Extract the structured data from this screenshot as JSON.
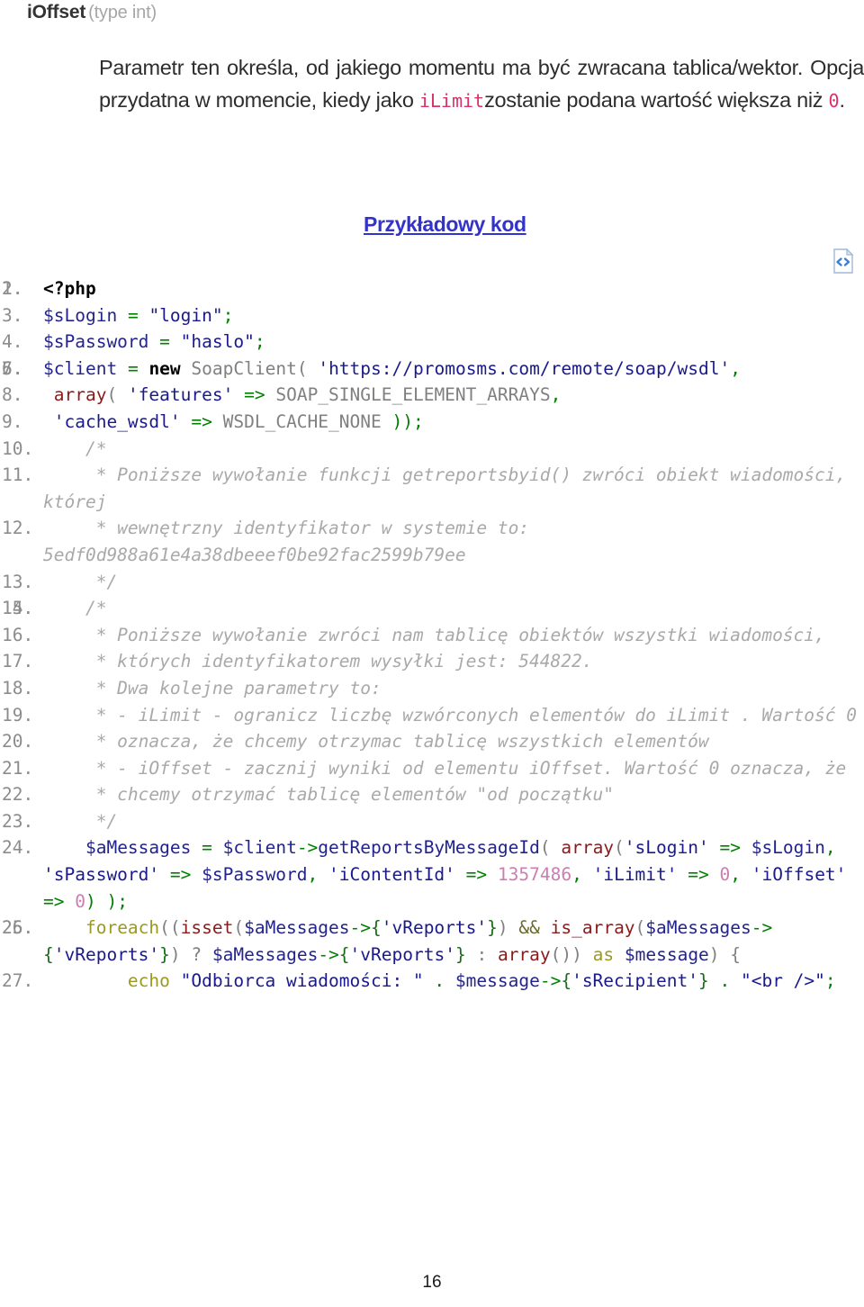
{
  "page": {
    "number": "16"
  },
  "param": {
    "name": "iOffset",
    "type_label": "(type int)"
  },
  "description": {
    "part1": "Parametr ten określa, od jakiego momentu ma być zwracana tablica/wektor. Opcja przydatna w momencie, kiedy jako ",
    "code1": "iLimit",
    "part2": "zostanie podana wartość większa niż ",
    "code2": "0",
    "part3": "."
  },
  "section": {
    "heading": "Przykładowy kod",
    "icon": "code-file-icon"
  },
  "code": {
    "language": "php",
    "lines": [
      {
        "n": "1.",
        "tokens": []
      },
      {
        "n": "2.",
        "tokens": [
          {
            "t": "kw",
            "s": "<?php"
          }
        ]
      },
      {
        "n": "3.",
        "tokens": [
          {
            "t": "var",
            "s": "$sLogin"
          },
          {
            "t": "plain",
            "s": " "
          },
          {
            "t": "op",
            "s": "="
          },
          {
            "t": "plain",
            "s": " "
          },
          {
            "t": "str",
            "s": "\"login\""
          },
          {
            "t": "op",
            "s": ";"
          }
        ]
      },
      {
        "n": "4.",
        "tokens": [
          {
            "t": "var",
            "s": "$sPassword"
          },
          {
            "t": "plain",
            "s": " "
          },
          {
            "t": "op",
            "s": "="
          },
          {
            "t": "plain",
            "s": " "
          },
          {
            "t": "str",
            "s": "\"haslo\""
          },
          {
            "t": "op",
            "s": ";"
          }
        ]
      },
      {
        "n": "5.",
        "tokens": []
      },
      {
        "n": "6.",
        "tokens": []
      },
      {
        "n": "7.",
        "tokens": [
          {
            "t": "var",
            "s": "$client"
          },
          {
            "t": "plain",
            "s": " "
          },
          {
            "t": "op",
            "s": "="
          },
          {
            "t": "plain",
            "s": " "
          },
          {
            "t": "kw",
            "s": "new"
          },
          {
            "t": "plain",
            "s": " "
          },
          {
            "t": "const",
            "s": "SoapClient"
          },
          {
            "t": "punc",
            "s": "("
          },
          {
            "t": "plain",
            "s": " "
          },
          {
            "t": "str",
            "s": "'https://promosms.com/remote/soap/wsdl'"
          },
          {
            "t": "op",
            "s": ","
          }
        ]
      },
      {
        "n": "8.",
        "tokens": [
          {
            "t": "plain",
            "s": " "
          },
          {
            "t": "fn",
            "s": "array"
          },
          {
            "t": "punc",
            "s": "("
          },
          {
            "t": "plain",
            "s": " "
          },
          {
            "t": "str",
            "s": "'features'"
          },
          {
            "t": "plain",
            "s": " "
          },
          {
            "t": "op",
            "s": "=>"
          },
          {
            "t": "plain",
            "s": " "
          },
          {
            "t": "const",
            "s": "SOAP_SINGLE_ELEMENT_ARRAYS"
          },
          {
            "t": "op",
            "s": ","
          }
        ]
      },
      {
        "n": "9.",
        "tokens": [
          {
            "t": "plain",
            "s": " "
          },
          {
            "t": "str",
            "s": "'cache_wsdl'"
          },
          {
            "t": "plain",
            "s": " "
          },
          {
            "t": "op",
            "s": "=>"
          },
          {
            "t": "plain",
            "s": " "
          },
          {
            "t": "const",
            "s": "WSDL_CACHE_NONE"
          },
          {
            "t": "plain",
            "s": " "
          },
          {
            "t": "op",
            "s": "));"
          }
        ]
      },
      {
        "n": "10.",
        "tokens": [
          {
            "t": "comment",
            "s": "    /*"
          }
        ]
      },
      {
        "n": "11.",
        "tokens": [
          {
            "t": "comment",
            "s": "     * Poniższe wywołanie funkcji getreportsbyid() zwróci obiekt wiadomości, której"
          }
        ]
      },
      {
        "n": "12.",
        "tokens": [
          {
            "t": "comment",
            "s": "     * wewnętrzny identyfikator w systemie to: 5edf0d988a61e4a38dbeeef0be92fac2599b79ee"
          }
        ]
      },
      {
        "n": "13.",
        "tokens": [
          {
            "t": "comment",
            "s": "     */"
          }
        ]
      },
      {
        "n": "14.",
        "tokens": []
      },
      {
        "n": "15.",
        "tokens": [
          {
            "t": "comment",
            "s": "    /*"
          }
        ]
      },
      {
        "n": "16.",
        "tokens": [
          {
            "t": "comment",
            "s": "     * Poniższe wywołanie zwróci nam tablicę obiektów wszystki wiadomości,"
          }
        ]
      },
      {
        "n": "17.",
        "tokens": [
          {
            "t": "comment",
            "s": "     * których identyfikatorem wysyłki jest: 544822."
          }
        ]
      },
      {
        "n": "18.",
        "tokens": [
          {
            "t": "comment",
            "s": "     * Dwa kolejne parametry to:"
          }
        ]
      },
      {
        "n": "19.",
        "tokens": [
          {
            "t": "comment",
            "s": "     * - iLimit - ogranicz liczbę wzwórconych elementów do iLimit . Wartość 0"
          }
        ]
      },
      {
        "n": "20.",
        "tokens": [
          {
            "t": "comment",
            "s": "     * oznacza, że chcemy otrzymac tablicę wszystkich elementów"
          }
        ]
      },
      {
        "n": "21.",
        "tokens": [
          {
            "t": "comment",
            "s": "     * - iOffset - zacznij wyniki od elementu iOffset. Wartość 0 oznacza, że"
          }
        ]
      },
      {
        "n": "22.",
        "tokens": [
          {
            "t": "comment",
            "s": "     * chcemy otrzymać tablicę elementów \"od początku\""
          }
        ]
      },
      {
        "n": "23.",
        "tokens": [
          {
            "t": "comment",
            "s": "     */"
          }
        ]
      },
      {
        "n": "24.",
        "tokens": [
          {
            "t": "plain",
            "s": "    "
          },
          {
            "t": "var",
            "s": "$aMessages"
          },
          {
            "t": "plain",
            "s": " "
          },
          {
            "t": "op",
            "s": "="
          },
          {
            "t": "plain",
            "s": " "
          },
          {
            "t": "var",
            "s": "$client"
          },
          {
            "t": "op",
            "s": "->"
          },
          {
            "t": "var",
            "s": "getReportsByMessageId"
          },
          {
            "t": "punc",
            "s": "("
          },
          {
            "t": "plain",
            "s": " "
          },
          {
            "t": "fn",
            "s": "array"
          },
          {
            "t": "punc",
            "s": "("
          },
          {
            "t": "str",
            "s": "'sLogin'"
          },
          {
            "t": "plain",
            "s": " "
          },
          {
            "t": "op",
            "s": "=>"
          },
          {
            "t": "plain",
            "s": " "
          },
          {
            "t": "var",
            "s": "$sLogin"
          },
          {
            "t": "op",
            "s": ","
          },
          {
            "t": "plain",
            "s": " "
          },
          {
            "t": "str",
            "s": "'sPassword'"
          },
          {
            "t": "plain",
            "s": " "
          },
          {
            "t": "op",
            "s": "=>"
          },
          {
            "t": "plain",
            "s": " "
          },
          {
            "t": "var",
            "s": "$sPassword"
          },
          {
            "t": "op",
            "s": ","
          },
          {
            "t": "plain",
            "s": " "
          },
          {
            "t": "str",
            "s": "'iContentId'"
          },
          {
            "t": "plain",
            "s": " "
          },
          {
            "t": "op",
            "s": "=>"
          },
          {
            "t": "plain",
            "s": " "
          },
          {
            "t": "num",
            "s": "1357486"
          },
          {
            "t": "op",
            "s": ","
          },
          {
            "t": "plain",
            "s": " "
          },
          {
            "t": "str",
            "s": "'iLimit'"
          },
          {
            "t": "plain",
            "s": " "
          },
          {
            "t": "op",
            "s": "=>"
          },
          {
            "t": "plain",
            "s": " "
          },
          {
            "t": "num",
            "s": "0"
          },
          {
            "t": "op",
            "s": ","
          },
          {
            "t": "plain",
            "s": " "
          },
          {
            "t": "str",
            "s": "'iOffset'"
          },
          {
            "t": "plain",
            "s": " "
          },
          {
            "t": "op",
            "s": "=>"
          },
          {
            "t": "plain",
            "s": " "
          },
          {
            "t": "num",
            "s": "0"
          },
          {
            "t": "op",
            "s": ")"
          },
          {
            "t": "plain",
            "s": " "
          },
          {
            "t": "op",
            "s": ");"
          }
        ]
      },
      {
        "n": "25.",
        "tokens": []
      },
      {
        "n": "26.",
        "tokens": [
          {
            "t": "plain",
            "s": "    "
          },
          {
            "t": "kw2",
            "s": "foreach"
          },
          {
            "t": "punc",
            "s": "(("
          },
          {
            "t": "fn",
            "s": "isset"
          },
          {
            "t": "punc",
            "s": "("
          },
          {
            "t": "var",
            "s": "$aMessages"
          },
          {
            "t": "op",
            "s": "->"
          },
          {
            "t": "brace",
            "s": "{"
          },
          {
            "t": "str",
            "s": "'vReports'"
          },
          {
            "t": "brace",
            "s": "}"
          },
          {
            "t": "punc",
            "s": ")"
          },
          {
            "t": "plain",
            "s": " "
          },
          {
            "t": "amp",
            "s": "&&"
          },
          {
            "t": "plain",
            "s": " "
          },
          {
            "t": "fn",
            "s": "is_array"
          },
          {
            "t": "punc",
            "s": "("
          },
          {
            "t": "var",
            "s": "$aMessages"
          },
          {
            "t": "op",
            "s": "->"
          },
          {
            "t": "brace",
            "s": "{"
          },
          {
            "t": "str",
            "s": "'vReports'"
          },
          {
            "t": "brace",
            "s": "}"
          },
          {
            "t": "punc",
            "s": ")"
          },
          {
            "t": "plain",
            "s": " "
          },
          {
            "t": "punc",
            "s": "?"
          },
          {
            "t": "plain",
            "s": " "
          },
          {
            "t": "var",
            "s": "$aMessages"
          },
          {
            "t": "op",
            "s": "->"
          },
          {
            "t": "brace",
            "s": "{"
          },
          {
            "t": "str",
            "s": "'vReports'"
          },
          {
            "t": "brace",
            "s": "}"
          },
          {
            "t": "plain",
            "s": " "
          },
          {
            "t": "punc",
            "s": ":"
          },
          {
            "t": "plain",
            "s": " "
          },
          {
            "t": "fn",
            "s": "array"
          },
          {
            "t": "punc",
            "s": "())"
          },
          {
            "t": "plain",
            "s": " "
          },
          {
            "t": "kw2",
            "s": "as"
          },
          {
            "t": "plain",
            "s": " "
          },
          {
            "t": "var",
            "s": "$message"
          },
          {
            "t": "punc",
            "s": ")"
          },
          {
            "t": "plain",
            "s": " "
          },
          {
            "t": "punc",
            "s": "{"
          }
        ]
      },
      {
        "n": "27.",
        "tokens": [
          {
            "t": "plain",
            "s": "        "
          },
          {
            "t": "kw2",
            "s": "echo"
          },
          {
            "t": "plain",
            "s": " "
          },
          {
            "t": "str",
            "s": "\"Odbiorca wiadomości: \""
          },
          {
            "t": "plain",
            "s": " "
          },
          {
            "t": "op",
            "s": "."
          },
          {
            "t": "plain",
            "s": " "
          },
          {
            "t": "var",
            "s": "$message"
          },
          {
            "t": "op",
            "s": "->"
          },
          {
            "t": "brace",
            "s": "{"
          },
          {
            "t": "str",
            "s": "'sRecipient'"
          },
          {
            "t": "brace",
            "s": "}"
          },
          {
            "t": "plain",
            "s": " "
          },
          {
            "t": "op",
            "s": "."
          },
          {
            "t": "plain",
            "s": " "
          },
          {
            "t": "str",
            "s": "\"<br />\""
          },
          {
            "t": "op",
            "s": ";"
          }
        ]
      }
    ]
  },
  "colors": {
    "heading_link": "#3333cc",
    "inline_code": "#d6336c",
    "comment": "#a9a9a9",
    "variable": "#23238e",
    "string": "#1a1a8c",
    "operator": "#008000",
    "function": "#8b1a1a",
    "keyword2": "#9a9a22",
    "number": "#cc7eb1",
    "line_number": "#8c8c8c"
  }
}
